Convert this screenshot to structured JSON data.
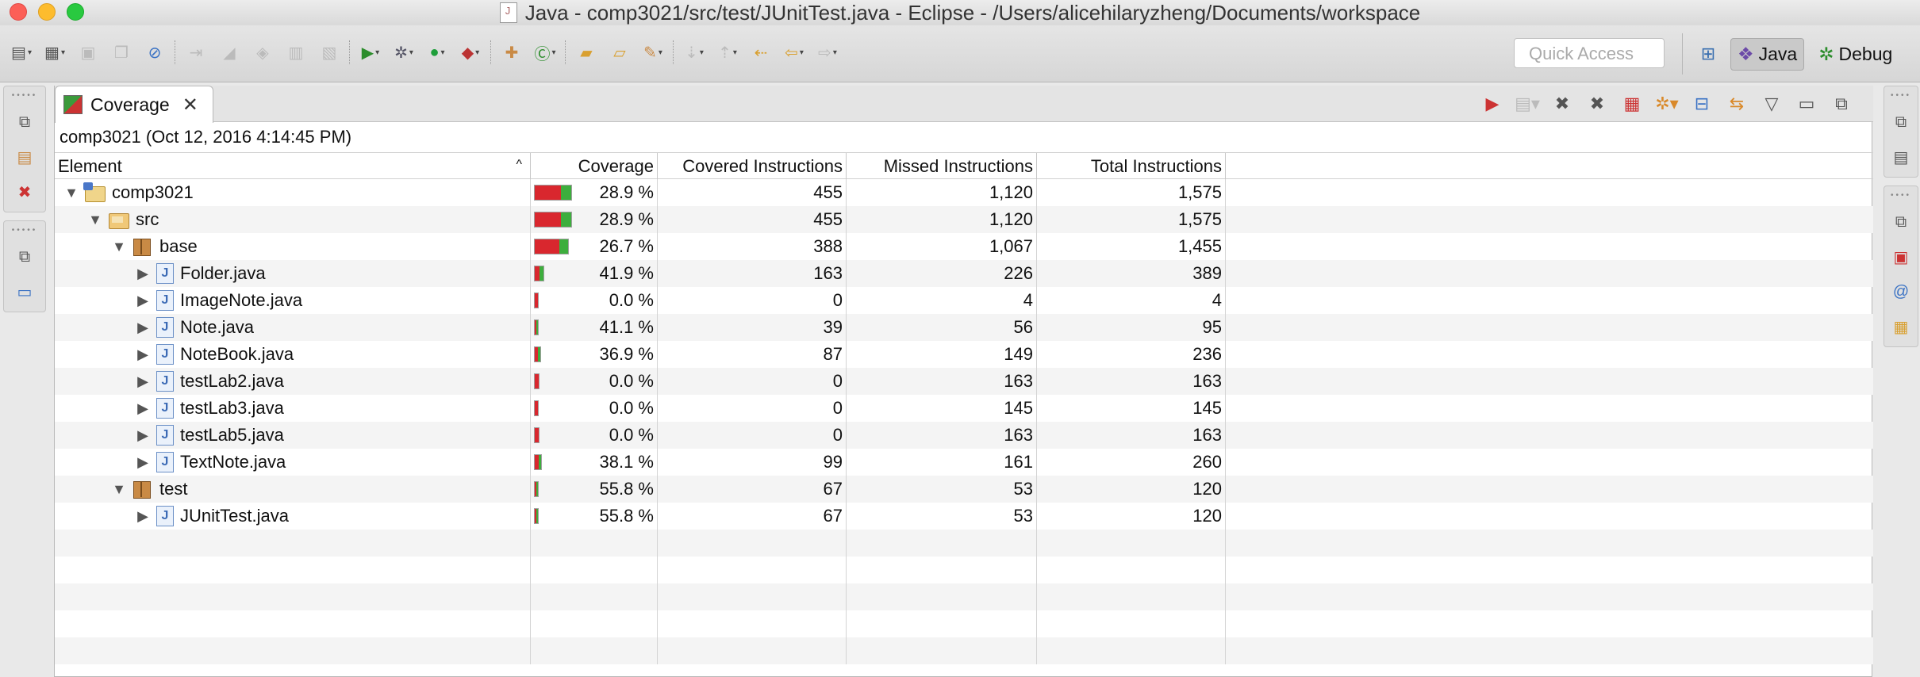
{
  "window": {
    "title": "Java - comp3021/src/test/JUnitTest.java - Eclipse - /Users/alicehilaryzheng/Documents/workspace"
  },
  "toolbar": {
    "quick_access_placeholder": "Quick Access",
    "perspectives": [
      {
        "label": "Java",
        "active": true,
        "icon": "java-perspective-icon"
      },
      {
        "label": "Debug",
        "active": false,
        "icon": "debug-perspective-icon"
      }
    ]
  },
  "coverage_view": {
    "tab_label": "Coverage",
    "session": "comp3021 (Oct 12, 2016 4:14:45 PM)",
    "columns": {
      "element": "Element",
      "coverage": "Coverage",
      "covered": "Covered Instructions",
      "missed": "Missed Instructions",
      "total": "Total Instructions"
    },
    "rows": [
      {
        "level": 0,
        "expanded": true,
        "type": "project",
        "name": "comp3021",
        "coverage": "28.9 %",
        "ratio": 0.289,
        "covered": "455",
        "missed": "1,120",
        "total": "1,575"
      },
      {
        "level": 1,
        "expanded": true,
        "type": "folder",
        "name": "src",
        "coverage": "28.9 %",
        "ratio": 0.289,
        "covered": "455",
        "missed": "1,120",
        "total": "1,575"
      },
      {
        "level": 2,
        "expanded": true,
        "type": "pkg",
        "name": "base",
        "coverage": "26.7 %",
        "ratio": 0.267,
        "covered": "388",
        "missed": "1,067",
        "total": "1,455"
      },
      {
        "level": 3,
        "expanded": false,
        "type": "java",
        "name": "Folder.java",
        "coverage": "41.9 %",
        "ratio": 0.419,
        "covered": "163",
        "missed": "226",
        "total": "389"
      },
      {
        "level": 3,
        "expanded": false,
        "type": "java",
        "name": "ImageNote.java",
        "coverage": "0.0 %",
        "ratio": 0.0,
        "covered": "0",
        "missed": "4",
        "total": "4"
      },
      {
        "level": 3,
        "expanded": false,
        "type": "java",
        "name": "Note.java",
        "coverage": "41.1 %",
        "ratio": 0.411,
        "covered": "39",
        "missed": "56",
        "total": "95"
      },
      {
        "level": 3,
        "expanded": false,
        "type": "java",
        "name": "NoteBook.java",
        "coverage": "36.9 %",
        "ratio": 0.369,
        "covered": "87",
        "missed": "149",
        "total": "236"
      },
      {
        "level": 3,
        "expanded": false,
        "type": "java",
        "name": "testLab2.java",
        "coverage": "0.0 %",
        "ratio": 0.0,
        "covered": "0",
        "missed": "163",
        "total": "163"
      },
      {
        "level": 3,
        "expanded": false,
        "type": "java",
        "name": "testLab3.java",
        "coverage": "0.0 %",
        "ratio": 0.0,
        "covered": "0",
        "missed": "145",
        "total": "145"
      },
      {
        "level": 3,
        "expanded": false,
        "type": "java",
        "name": "testLab5.java",
        "coverage": "0.0 %",
        "ratio": 0.0,
        "covered": "0",
        "missed": "163",
        "total": "163"
      },
      {
        "level": 3,
        "expanded": false,
        "type": "java",
        "name": "TextNote.java",
        "coverage": "38.1 %",
        "ratio": 0.381,
        "covered": "99",
        "missed": "161",
        "total": "260"
      },
      {
        "level": 2,
        "expanded": true,
        "type": "pkg",
        "name": "test",
        "coverage": "55.8 %",
        "ratio": 0.558,
        "covered": "67",
        "missed": "53",
        "total": "120"
      },
      {
        "level": 3,
        "expanded": false,
        "type": "java",
        "name": "JUnitTest.java",
        "coverage": "55.8 %",
        "ratio": 0.558,
        "covered": "67",
        "missed": "53",
        "total": "120"
      }
    ]
  },
  "colors": {
    "covered": "#3dae3d",
    "missed": "#d9272e"
  }
}
